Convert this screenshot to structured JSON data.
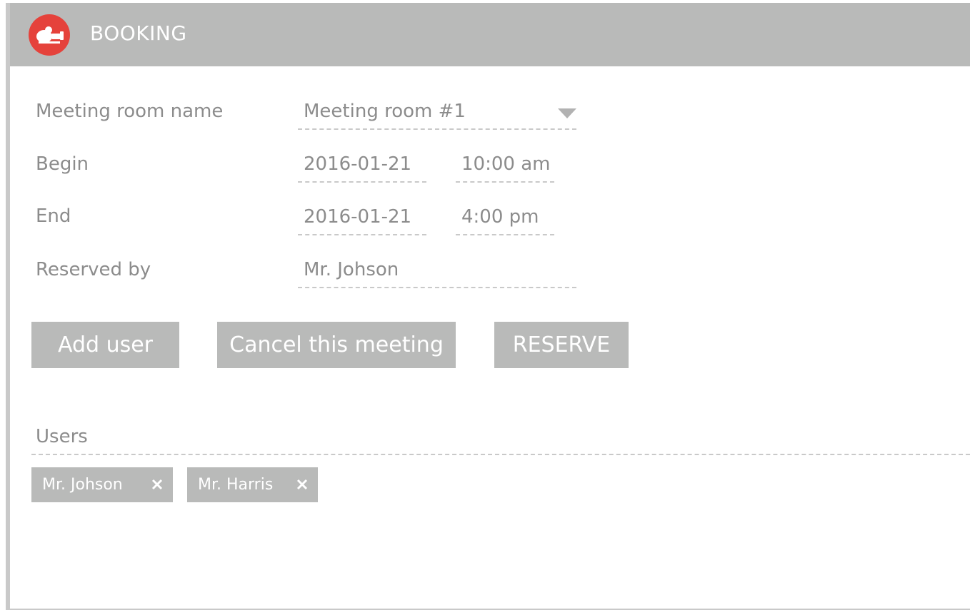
{
  "header": {
    "title": "BOOKING",
    "logo_icon": "app-logo-icon",
    "accent_color": "#e5423b"
  },
  "form": {
    "room": {
      "label": "Meeting room name",
      "value": "Meeting room #1"
    },
    "begin": {
      "label": "Begin",
      "date": "2016-01-21",
      "time": "10:00 am"
    },
    "end": {
      "label": "End",
      "date": "2016-01-21",
      "time": "4:00 pm"
    },
    "reserved_by": {
      "label": "Reserved by",
      "value": "Mr. Johson"
    }
  },
  "actions": {
    "add_user": "Add user",
    "cancel_meeting": "Cancel this meeting",
    "reserve": "RESERVE"
  },
  "users": {
    "label": "Users",
    "items": [
      {
        "name": "Mr. Johson"
      },
      {
        "name": "Mr. Harris"
      }
    ]
  },
  "icons": {
    "dropdown": "chevron-down-icon",
    "remove": "close-icon"
  }
}
